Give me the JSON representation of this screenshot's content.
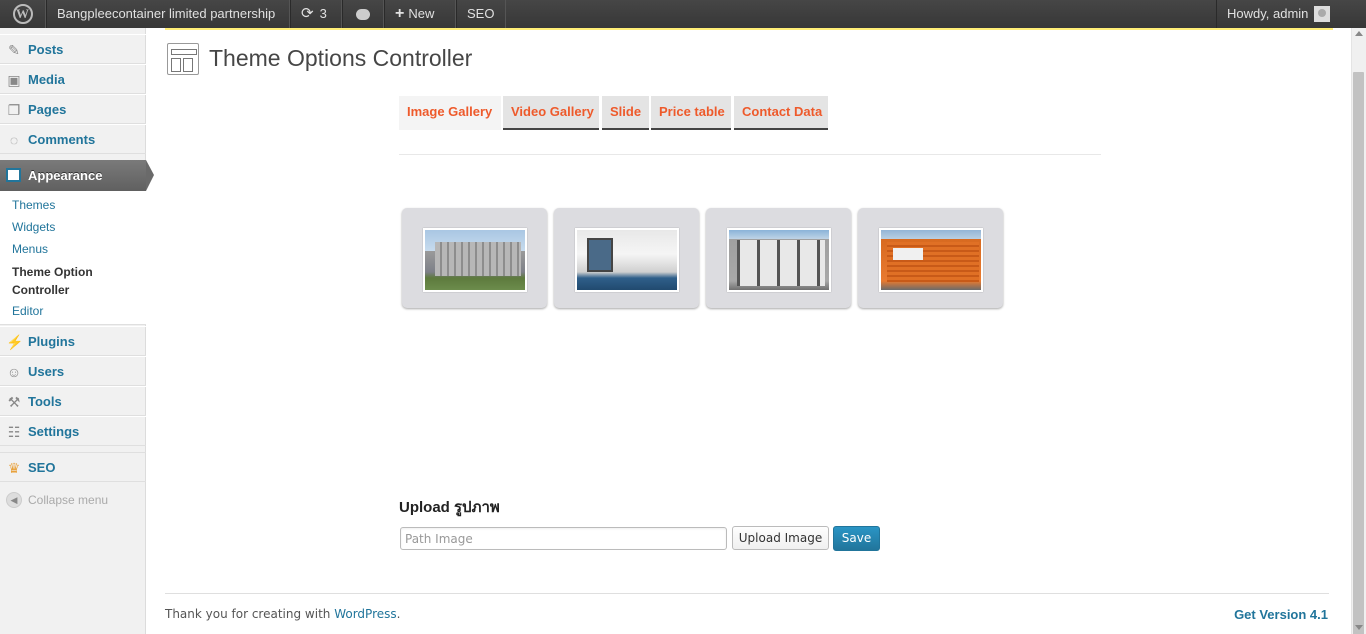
{
  "adminbar": {
    "site_name": "Bangpleecontainer limited partnership",
    "updates_count": "3",
    "new_label": "New",
    "seo_label": "SEO",
    "howdy": "Howdy, admin"
  },
  "sidebar": {
    "items": [
      {
        "label": "Posts",
        "icon": "pushpin-icon"
      },
      {
        "label": "Media",
        "icon": "media-icon"
      },
      {
        "label": "Pages",
        "icon": "pages-icon"
      },
      {
        "label": "Comments",
        "icon": "comments-icon"
      }
    ],
    "appearance": "Appearance",
    "submenu": [
      "Themes",
      "Widgets",
      "Menus",
      "Theme Option Controller",
      "Editor"
    ],
    "items_bottom": [
      {
        "label": "Plugins",
        "icon": "plugins-icon"
      },
      {
        "label": "Users",
        "icon": "users-icon"
      },
      {
        "label": "Tools",
        "icon": "tools-icon"
      },
      {
        "label": "Settings",
        "icon": "settings-icon"
      }
    ],
    "seo": "SEO",
    "collapse": "Collapse menu"
  },
  "main": {
    "title": "Theme Options Controller",
    "tabs": [
      "Image Gallery",
      "Video Gallery",
      "Slide",
      "Price table",
      "Contact Data"
    ],
    "active_tab": "Image Gallery",
    "upload_label": "Upload รูปภาพ",
    "path_placeholder": "Path Image",
    "upload_button": "Upload Image",
    "save_button": "Save"
  },
  "footer": {
    "thanks_prefix": "Thank you for creating with ",
    "wordpress_link": "WordPress",
    "thanks_suffix": ".",
    "version": "Get Version 4.1"
  },
  "colors": {
    "accent_link": "#21759b",
    "tab_text": "#ee5a2b"
  }
}
